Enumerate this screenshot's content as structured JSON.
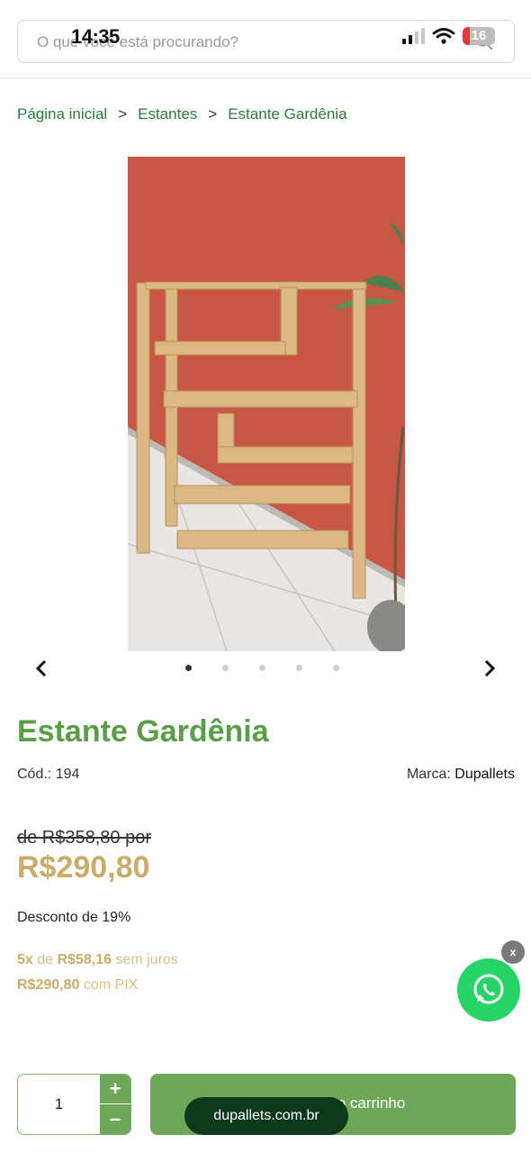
{
  "status_bar": {
    "time": "14:35",
    "battery_level": "16"
  },
  "search": {
    "placeholder": "O que você está procurando?"
  },
  "breadcrumb": [
    "Página inicial",
    "Estantes",
    "Estante Gardênia"
  ],
  "breadcrumb_separator": ">",
  "carousel": {
    "slides": 5,
    "active_index": 0
  },
  "product": {
    "title": "Estante Gardênia",
    "code_label": "Cód.:",
    "code": "194",
    "brand_label": "Marca:",
    "brand": "Dupallets",
    "old_price": "de R$358,80 por",
    "price": "R$290,80",
    "discount": "Desconto de 19%",
    "installments_count": "5x",
    "installments_of": "de",
    "installments_value": "R$58,16",
    "installments_suffix": "sem juros",
    "pix_price": "R$290,80",
    "pix_suffix": "com PIX"
  },
  "whatsapp": {
    "close_label": "x"
  },
  "cart": {
    "quantity": "1",
    "plus": "+",
    "minus": "–",
    "add_label": "Adicionar ao carrinho"
  },
  "browser": {
    "url": "dupallets.com.br"
  },
  "colors": {
    "brand_green": "#5a9e48",
    "button_green": "#6fa75a",
    "price_gold": "#c9ac6b",
    "whatsapp": "#25d366"
  }
}
